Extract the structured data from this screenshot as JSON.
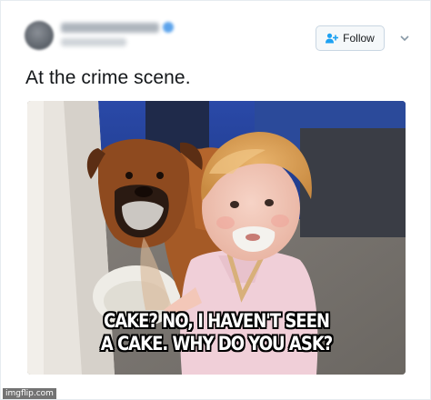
{
  "tweet": {
    "author_name": "",
    "author_handle": "",
    "follow_label": "Follow",
    "text": "At the crime scene."
  },
  "photo": {
    "caption_line1": "CAKE? NO, I HAVEN'T SEEN",
    "caption_line2": "A CAKE. WHY DO YOU ASK?"
  },
  "watermark": "imgflip.com",
  "colors": {
    "follow_icon": "#1da1f2",
    "text": "#14171a"
  },
  "icons": [
    "add-user-icon",
    "chevron-down-icon"
  ]
}
